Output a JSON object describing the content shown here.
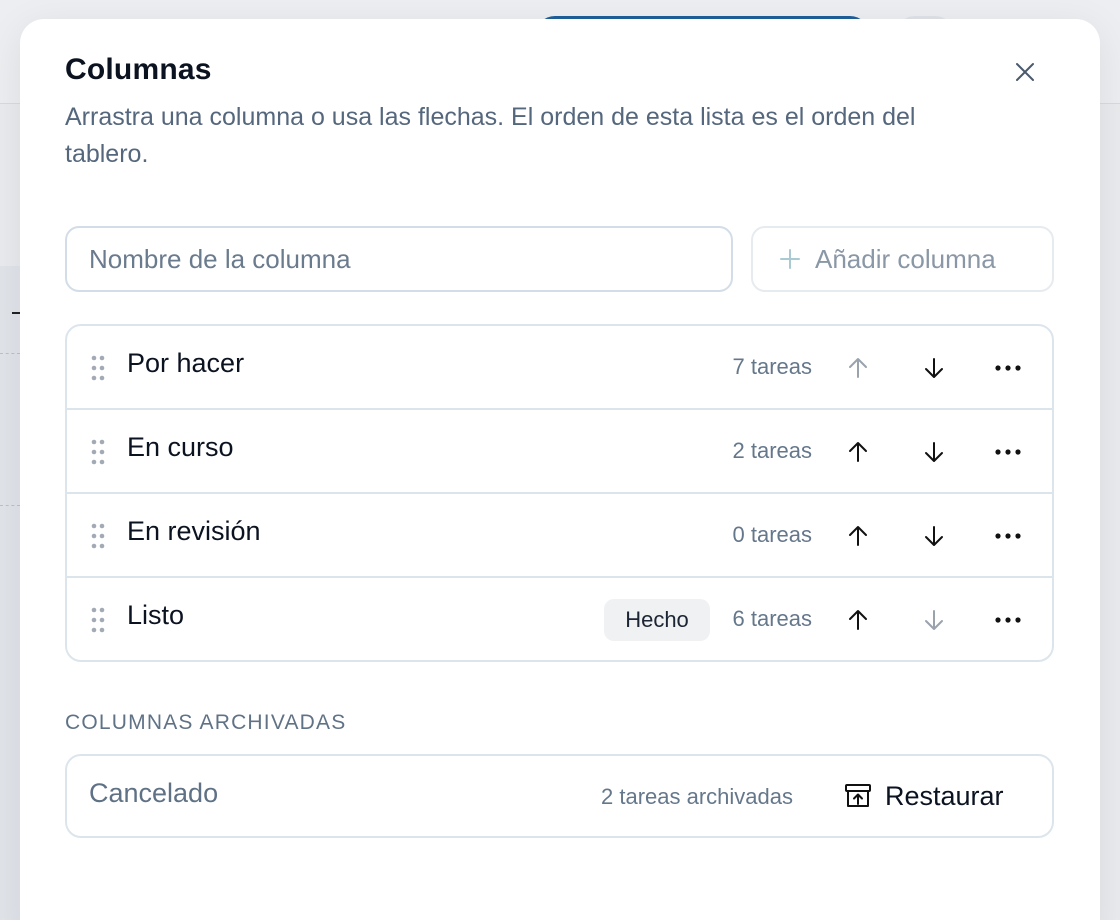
{
  "modal": {
    "title": "Columnas",
    "subtitle": "Arrastra una columna o usa las flechas. El orden de esta lista es el orden del tablero.",
    "close_icon": "close-icon"
  },
  "add": {
    "placeholder": "Nombre de la columna",
    "button_label": "Añadir columna",
    "button_icon": "plus-icon"
  },
  "columns": [
    {
      "name": "Por hacer",
      "badge": "",
      "count": "7 tareas",
      "up_enabled": false,
      "down_enabled": true
    },
    {
      "name": "En curso",
      "badge": "",
      "count": "2 tareas",
      "up_enabled": true,
      "down_enabled": true
    },
    {
      "name": "En revisión",
      "badge": "",
      "count": "0 tareas",
      "up_enabled": true,
      "down_enabled": true
    },
    {
      "name": "Listo",
      "badge": "Hecho",
      "count": "6 tareas",
      "up_enabled": true,
      "down_enabled": false
    }
  ],
  "archived": {
    "label": "COLUMNAS ARCHIVADAS",
    "items": [
      {
        "name": "Cancelado",
        "count": "2 tareas archivadas",
        "restore_label": "Restaurar",
        "restore_icon": "archive-restore-icon"
      }
    ]
  },
  "colors": {
    "enabled_icon": "#111111",
    "disabled_icon": "#9aa3ad",
    "border": "#dde5ec",
    "muted_text": "#65778b"
  }
}
